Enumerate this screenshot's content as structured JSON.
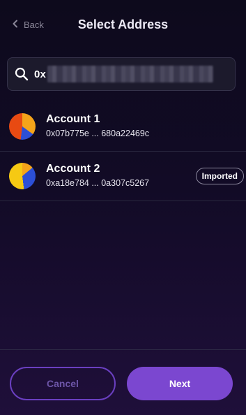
{
  "header": {
    "back_label": "Back",
    "title": "Select Address"
  },
  "search": {
    "value": "0x"
  },
  "accounts": [
    {
      "name": "Account 1",
      "address": "0x07b775e ... 680a22469c",
      "badge": ""
    },
    {
      "name": "Account 2",
      "address": "0xa18e784 ... 0a307c5267",
      "badge": "Imported"
    }
  ],
  "buttons": {
    "cancel_label": "Cancel",
    "next_label": "Next"
  },
  "colors": {
    "accent": "#7b47d0",
    "cancel_text": "#6d55a8",
    "background": "#0d0a1c"
  },
  "icons": {
    "back": "chevron-left-icon",
    "search": "search-icon"
  }
}
